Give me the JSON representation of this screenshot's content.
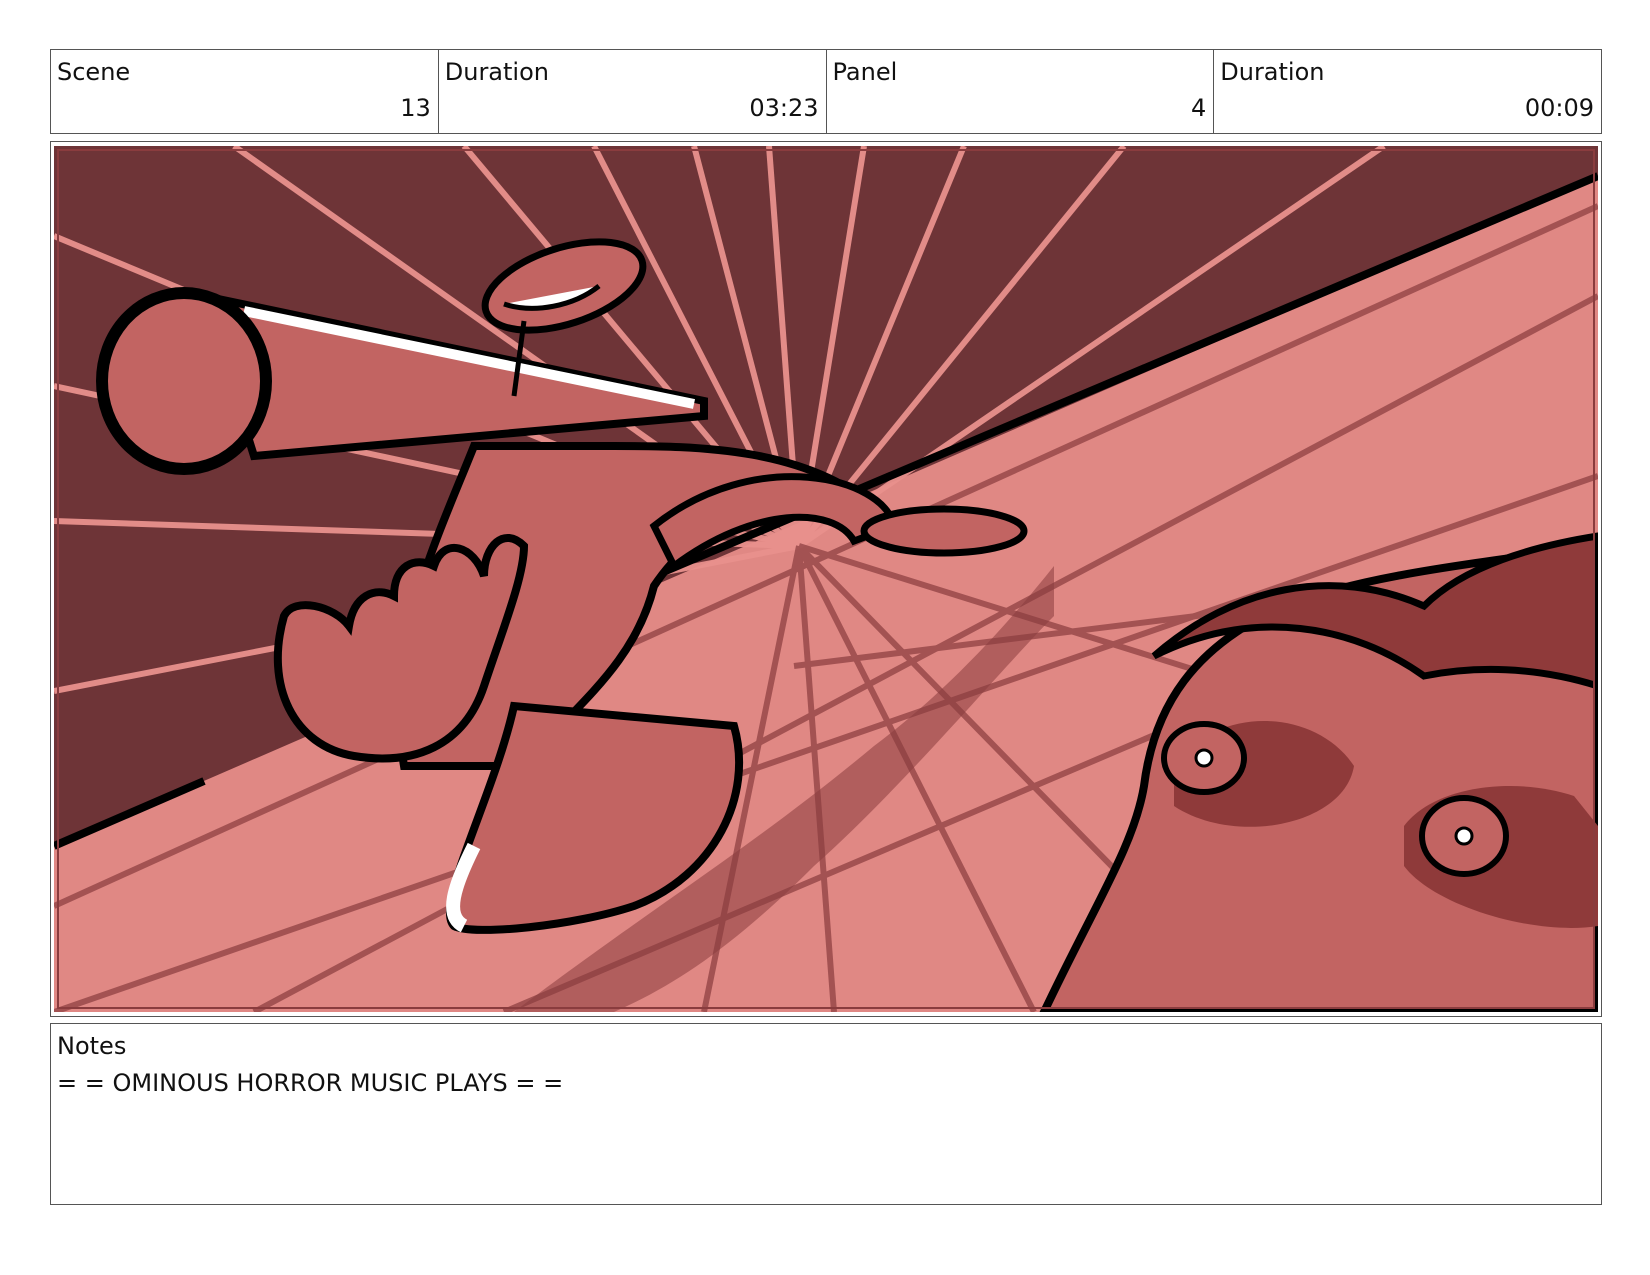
{
  "header": {
    "scene_label": "Scene",
    "scene_value": "13",
    "scene_duration_label": "Duration",
    "scene_duration_value": "03:23",
    "panel_label": "Panel",
    "panel_value": "4",
    "panel_duration_label": "Duration",
    "panel_duration_value": "00:09"
  },
  "panel_image": {
    "icon": "storyboard-drawing",
    "palette": {
      "dark_wall": "#6e3437",
      "floor": "#e08884",
      "figure": "#c26462",
      "shadow": "#8f3a3a",
      "ray": "#e9918d",
      "ink": "#000000"
    }
  },
  "notes": {
    "label": "Notes",
    "text": "= = OMINOUS HORROR MUSIC PLAYS = ="
  }
}
